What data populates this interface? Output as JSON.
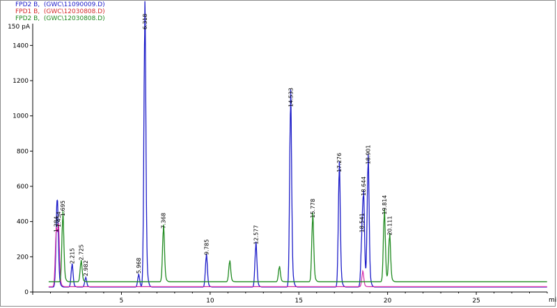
{
  "legend": [
    {
      "text": "FPD2 B,  (GWC\\11090009.D)",
      "color": "#1b1bc8"
    },
    {
      "text": "FPD1 B,  (GWC\\12030808.D)",
      "color": "#d42a2a"
    },
    {
      "text": "FPD2 B,  (GWC\\12030808.D)",
      "color": "#1f8a1f"
    }
  ],
  "chart_data": {
    "type": "line",
    "title": "",
    "xlabel": "min",
    "ylabel": "pA",
    "xlim": [
      0,
      29
    ],
    "ylim": [
      0,
      1500
    ],
    "x_ticks": [
      5,
      10,
      15,
      20,
      25
    ],
    "y_ticks": [
      0,
      200,
      400,
      600,
      800,
      1000,
      1200,
      1400
    ],
    "y_top_label": "150 pA",
    "grid": false,
    "series": [
      {
        "name": "FPD2 B,  (GWC\\11090009.D)",
        "color": "#1b1bc8",
        "baseline": 28,
        "peaks": [
          {
            "rt": 1.35,
            "height": 245,
            "label": ""
          },
          {
            "rt": 1.4,
            "height": 270,
            "label": ""
          },
          {
            "rt": 2.215,
            "height": 120,
            "label": "2.215"
          },
          {
            "rt": 2.982,
            "height": 50,
            "label": "2.982"
          },
          {
            "rt": 5.968,
            "height": 65,
            "label": "5.968"
          },
          {
            "rt": 6.318,
            "height": 1450,
            "label": "6.318"
          },
          {
            "rt": 9.785,
            "height": 170,
            "label": "9.785"
          },
          {
            "rt": 12.577,
            "height": 230,
            "label": "12.577"
          },
          {
            "rt": 14.533,
            "height": 1010,
            "label": "14.533"
          },
          {
            "rt": 17.276,
            "height": 640,
            "label": "17.276"
          },
          {
            "rt": 18.541,
            "height": 220,
            "label": "18.541"
          },
          {
            "rt": 18.644,
            "height": 450,
            "label": "18.644"
          },
          {
            "rt": 18.901,
            "height": 680,
            "label": "18.901"
          }
        ]
      },
      {
        "name": "FPD1 B,  (GWC\\12030808.D)",
        "color": "#d42aa8",
        "baseline": 30,
        "peaks": [
          {
            "rt": 1.32,
            "height": 280,
            "label": "1.384"
          },
          {
            "rt": 1.45,
            "height": 290,
            "label": "1.454"
          },
          {
            "rt": 18.6,
            "height": 80,
            "label": ""
          }
        ]
      },
      {
        "name": "FPD2 B,  (GWC\\12030808.D)",
        "color": "#1f8a1f",
        "baseline": 58,
        "peaks": [
          {
            "rt": 1.695,
            "height": 360,
            "label": "1.695"
          },
          {
            "rt": 2.725,
            "height": 110,
            "label": "2.725"
          },
          {
            "rt": 7.368,
            "height": 290,
            "label": "7.368"
          },
          {
            "rt": 11.1,
            "height": 110,
            "label": ""
          },
          {
            "rt": 13.9,
            "height": 80,
            "label": ""
          },
          {
            "rt": 15.778,
            "height": 350,
            "label": "15.778"
          },
          {
            "rt": 19.814,
            "height": 370,
            "label": "19.814"
          },
          {
            "rt": 20.111,
            "height": 250,
            "label": "20.111"
          }
        ]
      }
    ]
  }
}
